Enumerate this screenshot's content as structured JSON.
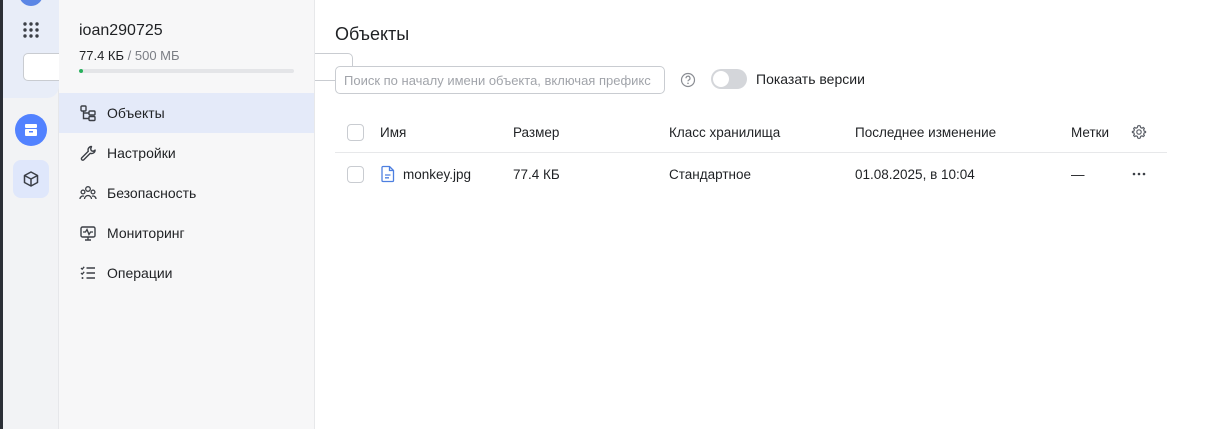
{
  "rail": {
    "icons": [
      "apps-grid-icon",
      "search-icon",
      "object-storage-icon",
      "cube-icon"
    ]
  },
  "sidebar": {
    "bucket_name": "ioan290725",
    "usage_used": "77.4 КБ",
    "usage_total": " / 500 МБ",
    "usage_fraction": 0.0002,
    "items": [
      {
        "label": "Объекты",
        "icon": "objects-icon",
        "active": true
      },
      {
        "label": "Настройки",
        "icon": "wrench-icon",
        "active": false
      },
      {
        "label": "Безопасность",
        "icon": "users-icon",
        "active": false
      },
      {
        "label": "Мониторинг",
        "icon": "monitor-icon",
        "active": false
      },
      {
        "label": "Операции",
        "icon": "operations-list-icon",
        "active": false
      }
    ]
  },
  "main": {
    "title": "Объекты",
    "search_placeholder": "Поиск по началу имени объекта, включая префикс",
    "search_value": "",
    "show_versions_label": "Показать версии",
    "show_versions_on": false
  },
  "table": {
    "columns": {
      "name": "Имя",
      "size": "Размер",
      "storage_class": "Класс хранилища",
      "modified": "Последнее изменение",
      "tags": "Метки"
    },
    "rows": [
      {
        "name": "monkey.jpg",
        "size": "77.4 КБ",
        "storage_class": "Стандартное",
        "modified": "01.08.2025, в 10:04",
        "tags": "—"
      }
    ]
  },
  "colors": {
    "accent": "#5282ff",
    "active_nav_bg": "#e4eaf9",
    "usage_fill": "#27b05b",
    "file_icon": "#4d7fe0"
  }
}
